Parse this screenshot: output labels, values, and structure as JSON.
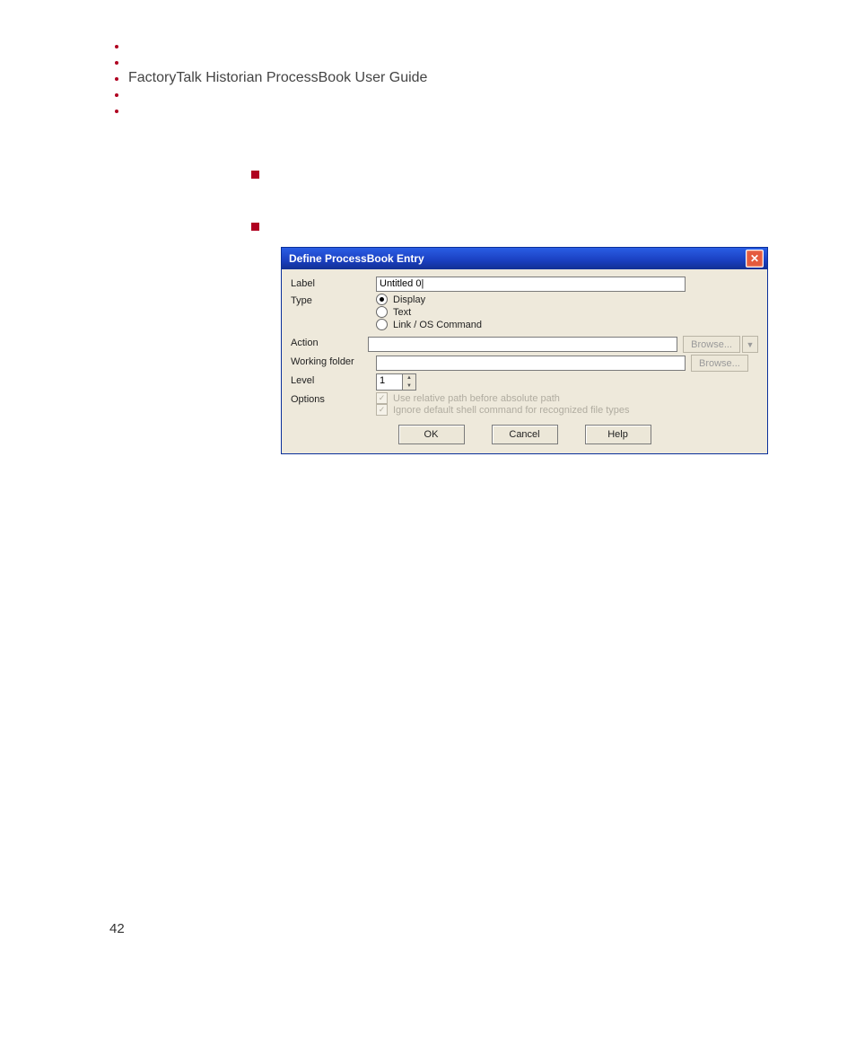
{
  "doc_title": "FactoryTalk Historian ProcessBook User Guide",
  "page_number": "42",
  "dialog": {
    "title": "Define ProcessBook Entry",
    "fields": {
      "label_label": "Label",
      "label_value": "Untitled 0|",
      "type_label": "Type",
      "type_options": {
        "display": "Display",
        "text": "Text",
        "link": "Link / OS Command"
      },
      "action_label": "Action",
      "action_value": "",
      "wf_label": "Working folder",
      "wf_value": "",
      "level_label": "Level",
      "level_value": "1",
      "options_label": "Options",
      "opt1": "Use relative path before absolute path",
      "opt2": "Ignore default shell command for recognized file types"
    },
    "browse": "Browse...",
    "buttons": {
      "ok": "OK",
      "cancel": "Cancel",
      "help": "Help"
    },
    "close": "✕"
  }
}
